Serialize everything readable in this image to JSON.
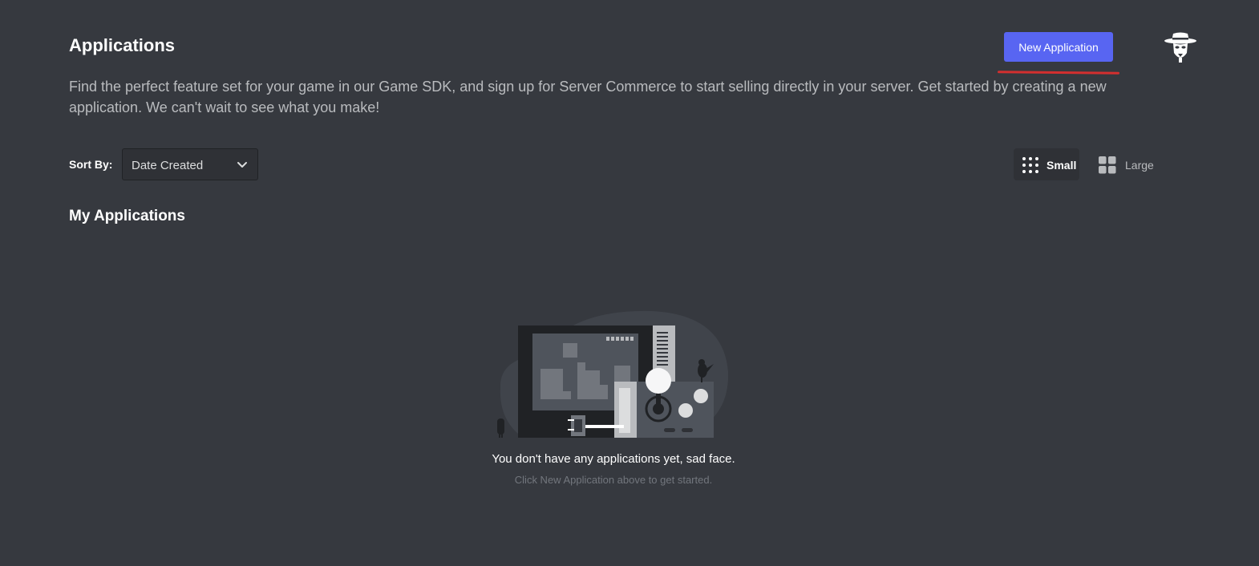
{
  "header": {
    "title": "Applications",
    "new_application_label": "New Application",
    "avatar_icon": "hat-mask-avatar-icon"
  },
  "description": "Find the perfect feature set for your game in our Game SDK, and sign up for Server Commerce to start selling directly in your server. Get started by creating a new application. We can't wait to see what you make!",
  "controls": {
    "sort_label": "Sort By:",
    "sort_value": "Date Created",
    "sort_icon": "chevron-down-icon",
    "view_options": [
      {
        "label": "Small",
        "icon": "dots-grid-icon",
        "selected": true
      },
      {
        "label": "Large",
        "icon": "squares-grid-icon",
        "selected": false
      }
    ]
  },
  "section": {
    "title": "My Applications"
  },
  "empty_state": {
    "illustration": "arcade-machine-illustration",
    "title": "You don't have any applications yet, sad face.",
    "subtitle": "Click New Application above to get started."
  },
  "colors": {
    "background": "#36393f",
    "accent": "#5865f2",
    "highlight_underline": "#d32f2f"
  }
}
